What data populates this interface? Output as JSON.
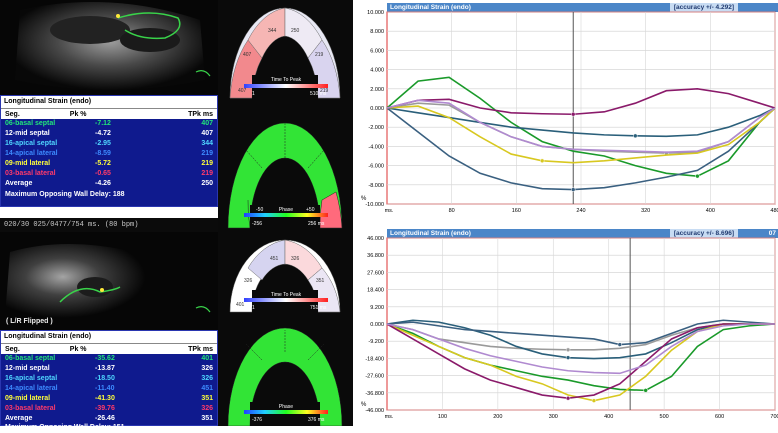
{
  "top": {
    "us_caption": "",
    "table_title": "Longitudinal Strain (endo)",
    "col_seg": "Seg.",
    "col_pk": "Pk %",
    "col_tpk": "TPk ms",
    "rows": [
      {
        "seg": "06-basal septal",
        "pk": "-7.12",
        "tpk": "407",
        "color": "#22e37a"
      },
      {
        "seg": "12-mid septal",
        "pk": "-4.72",
        "tpk": "407",
        "color": "#ffffff"
      },
      {
        "seg": "16-apical septal",
        "pk": "-2.95",
        "tpk": "344",
        "color": "#4fd6ff"
      },
      {
        "seg": "14-apical lateral",
        "pk": "-8.59",
        "tpk": "219",
        "color": "#3d8bff"
      },
      {
        "seg": "09-mid lateral",
        "pk": "-5.72",
        "tpk": "219",
        "color": "#ffff3a"
      },
      {
        "seg": "03-basal lateral",
        "pk": "-0.65",
        "tpk": "219",
        "color": "#ff3a6a"
      },
      {
        "seg": "Average",
        "pk": "-4.26",
        "tpk": "250",
        "color": "#ffffff"
      }
    ],
    "footer": "Maximum Opposing Wall Delay: 188",
    "status_line": "020/30  025/0477/754 ms. (80 bpm)"
  },
  "bottom": {
    "flip_label": "( L/R Flipped )",
    "table_title": "Longitudinal Strain (endo)",
    "col_seg": "Seg.",
    "col_pk": "Pk %",
    "col_tpk": "TPk ms",
    "rows": [
      {
        "seg": "06-basal septal",
        "pk": "-35.62",
        "tpk": "401",
        "color": "#22e37a"
      },
      {
        "seg": "12-mid septal",
        "pk": "-13.87",
        "tpk": "326",
        "color": "#ffffff"
      },
      {
        "seg": "16-apical septal",
        "pk": "-18.50",
        "tpk": "326",
        "color": "#4fd6ff"
      },
      {
        "seg": "14-apical lateral",
        "pk": "-11.40",
        "tpk": "451",
        "color": "#3d8bff"
      },
      {
        "seg": "09-mid lateral",
        "pk": "-41.30",
        "tpk": "351",
        "color": "#ffff3a"
      },
      {
        "seg": "03-basal lateral",
        "pk": "-39.76",
        "tpk": "326",
        "color": "#ff3a6a"
      },
      {
        "seg": "Average",
        "pk": "-26.46",
        "tpk": "351",
        "color": "#ffffff"
      }
    ],
    "footer": "Maximum Opposing Wall Delay: 151"
  },
  "bullseye_top": {
    "ttp_label": "Time To Peak",
    "ttp_min": "1",
    "ttp_max": "510 ms",
    "ttp_values": [
      "407",
      "344",
      "250",
      "219",
      "219"
    ],
    "phase_label": "Phase",
    "phase_min": "-256",
    "phase_max": "256 ms",
    "phase_scale_left": "-50",
    "phase_scale_right": "+50"
  },
  "bullseye_bottom": {
    "ttp_label": "Time To Peak",
    "ttp_min": "1",
    "ttp_max": "751 ms",
    "ttp_values": [
      "401",
      "326",
      "451",
      "326",
      "351"
    ],
    "phase_label": "Phase",
    "phase_min": "-376",
    "phase_max": "376 ms"
  },
  "chart_top": {
    "title": "Longitudinal Strain (endo)",
    "accuracy": "[accuracy +/- 4.292]",
    "y_ticks": [
      "10.000",
      "8.000",
      "6.000",
      "4.000",
      "2.000",
      "0.000",
      "-2.000",
      "-4.000",
      "-6.000",
      "-8.000",
      "-10.000"
    ],
    "x_ticks": [
      "ms.",
      "80",
      "160",
      "240",
      "320",
      "400",
      "480"
    ],
    "ylabel": "%"
  },
  "chart_bottom": {
    "title": "Longitudinal Strain (endo)",
    "accuracy": "[accuracy +/- 8.696]",
    "corner": "07",
    "y_ticks": [
      "46.000",
      "36.800",
      "27.600",
      "18.400",
      "9.200",
      "0.000",
      "-9.200",
      "-18.400",
      "-27.600",
      "-36.800",
      "-46.000"
    ],
    "x_ticks": [
      "ms.",
      "100",
      "200",
      "300",
      "400",
      "500",
      "600",
      "700"
    ],
    "ylabel": "%"
  },
  "chart_data": [
    {
      "type": "line",
      "title": "Longitudinal Strain (endo)",
      "ylim": [
        -10,
        10
      ],
      "xlim": [
        0,
        500
      ],
      "x": [
        0,
        40,
        80,
        120,
        160,
        200,
        240,
        280,
        320,
        360,
        400,
        440,
        480,
        500
      ],
      "series": [
        {
          "name": "06-basal septal",
          "color": "#1a9a2a",
          "values": [
            0,
            2.8,
            3.2,
            1,
            -1.5,
            -3.5,
            -4.5,
            -5,
            -6,
            -6.8,
            -7.1,
            -5.5,
            -1.5,
            0
          ]
        },
        {
          "name": "12-mid septal",
          "color": "#9a9a9a",
          "values": [
            0,
            0.5,
            0.3,
            -1.5,
            -3,
            -4,
            -4.3,
            -4.5,
            -4.6,
            -4.7,
            -4.6,
            -3.5,
            -1,
            0
          ]
        },
        {
          "name": "16-apical septal",
          "color": "#2a5f7a",
          "values": [
            0,
            -0.5,
            -1,
            -1.5,
            -2,
            -2.3,
            -2.6,
            -2.8,
            -2.9,
            -2.95,
            -2.8,
            -2,
            -0.8,
            0
          ]
        },
        {
          "name": "14-apical lateral",
          "color": "#3a6080",
          "values": [
            0,
            -2.5,
            -5,
            -6.8,
            -7.8,
            -8.4,
            -8.5,
            -8.3,
            -7.8,
            -7.2,
            -6.5,
            -4.5,
            -1.5,
            0
          ]
        },
        {
          "name": "09-mid lateral",
          "color": "#d8c820",
          "values": [
            0,
            0.2,
            -1,
            -3,
            -4.8,
            -5.5,
            -5.7,
            -5.5,
            -5.2,
            -4.9,
            -4.7,
            -3.8,
            -1.5,
            0
          ]
        },
        {
          "name": "03-basal lateral",
          "color": "#8a1a6a",
          "values": [
            0,
            0.8,
            0.9,
            0,
            -0.5,
            -0.6,
            -0.65,
            -0.4,
            0.5,
            1.8,
            2,
            1.5,
            0.5,
            0
          ]
        },
        {
          "name": "Average",
          "color": "#b08ad0",
          "values": [
            0,
            0.8,
            0.5,
            -1.5,
            -3,
            -4,
            -4.3,
            -4.4,
            -4.5,
            -4.6,
            -4.5,
            -3.5,
            -1,
            0
          ]
        }
      ]
    },
    {
      "type": "line",
      "title": "Longitudinal Strain (endo)",
      "ylim": [
        -46,
        46
      ],
      "xlim": [
        0,
        750
      ],
      "x": [
        0,
        50,
        100,
        150,
        200,
        250,
        300,
        350,
        400,
        450,
        500,
        550,
        600,
        650,
        700,
        750
      ],
      "series": [
        {
          "name": "06-basal septal",
          "color": "#1a9a2a",
          "values": [
            0,
            -5,
            -12,
            -18,
            -22,
            -25,
            -28,
            -30,
            -33,
            -35,
            -35.5,
            -28,
            -12,
            -3,
            -1,
            0
          ]
        },
        {
          "name": "12-mid septal",
          "color": "#9a9a9a",
          "values": [
            0,
            -3,
            -8,
            -10,
            -12,
            -13,
            -13.5,
            -13.8,
            -13.8,
            -13,
            -11,
            -6,
            -2,
            0,
            0,
            0
          ]
        },
        {
          "name": "16-apical septal",
          "color": "#2a5f7a",
          "values": [
            0,
            2,
            1,
            -2,
            -6,
            -12,
            -16,
            -18,
            -18.5,
            -18,
            -16,
            -10,
            -3,
            0,
            0,
            0
          ]
        },
        {
          "name": "14-apical lateral",
          "color": "#3a6080",
          "values": [
            0,
            1,
            -1,
            -3,
            -4,
            -5,
            -6,
            -7,
            -8,
            -11,
            -10,
            -5,
            0,
            2,
            1,
            0
          ]
        },
        {
          "name": "09-mid lateral",
          "color": "#d8c820",
          "values": [
            0,
            -6,
            -12,
            -18,
            -22,
            -28,
            -32,
            -38,
            -41,
            -38,
            -28,
            -14,
            -4,
            0,
            0,
            0
          ]
        },
        {
          "name": "03-basal lateral",
          "color": "#8a1a6a",
          "values": [
            0,
            -8,
            -16,
            -24,
            -30,
            -34,
            -38,
            -39.7,
            -38,
            -32,
            -20,
            -8,
            -2,
            0,
            0,
            0
          ]
        },
        {
          "name": "Average",
          "color": "#b08ad0",
          "values": [
            0,
            -3,
            -8,
            -13,
            -17,
            -20,
            -23,
            -25,
            -26,
            -26.4,
            -22,
            -12,
            -4,
            -1,
            0,
            0
          ]
        }
      ]
    }
  ]
}
